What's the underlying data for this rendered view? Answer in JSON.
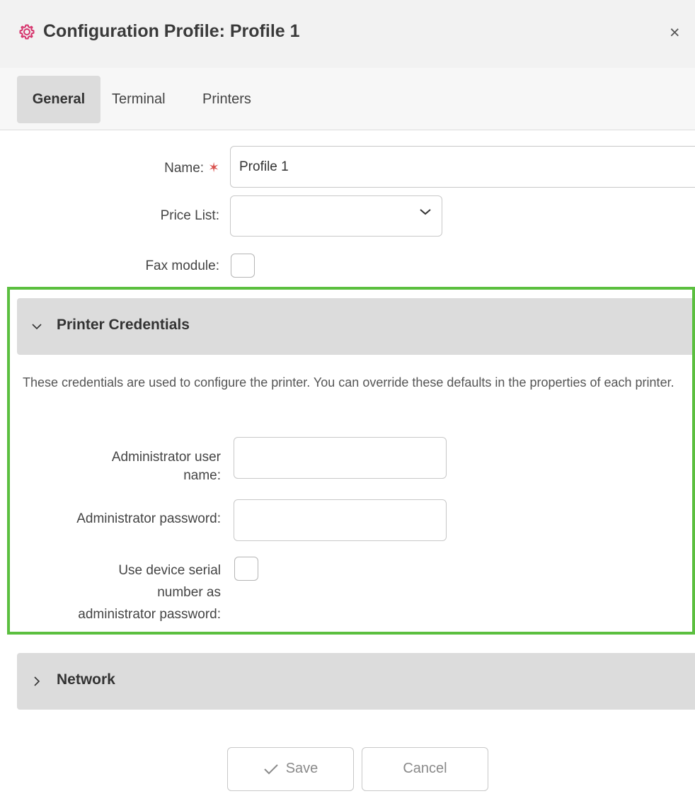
{
  "dialog": {
    "title": "Configuration Profile: Profile 1",
    "close_symbol": "×",
    "accent_color": "#d6336c",
    "highlight_color": "#5bbf3f"
  },
  "tabs": [
    {
      "label": "General",
      "active": true
    },
    {
      "label": "Terminal",
      "active": false
    },
    {
      "label": "Printers",
      "active": false
    }
  ],
  "general": {
    "name_label": "Name:",
    "name_required_mark": "✶",
    "name_value": "Profile 1",
    "price_list_label": "Price List:",
    "price_list_value": "",
    "fax_label": "Fax module:",
    "fax_checked": false
  },
  "printer_credentials": {
    "title": "Printer Credentials",
    "expanded": true,
    "description": "These credentials are used to configure the printer. You can override these defaults in the properties of each printer.",
    "admin_user_label_line1": "Administrator user",
    "admin_user_label_line2": "name:",
    "admin_user_value": "",
    "admin_password_label": "Administrator password:",
    "admin_password_value": "",
    "serial_label_line1": "Use device serial",
    "serial_label_line2": "number as",
    "serial_label_line3": "administrator password:",
    "serial_checked": false
  },
  "network": {
    "title": "Network",
    "expanded": false
  },
  "footer": {
    "save_label": "Save",
    "cancel_label": "Cancel"
  }
}
